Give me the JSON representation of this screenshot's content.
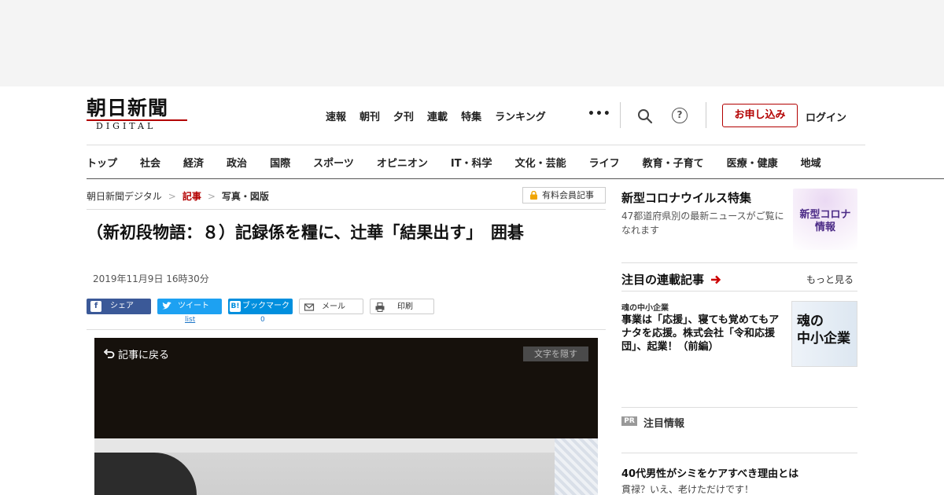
{
  "logo": {
    "jp": "朝日新聞",
    "en": "DIGITAL"
  },
  "topnav": [
    "速報",
    "朝刊",
    "夕刊",
    "連載",
    "特集",
    "ランキング"
  ],
  "more_dots": "•••",
  "header": {
    "apply_label": "お申し込み",
    "login_label": "ログイン",
    "help_glyph": "?"
  },
  "catnav": [
    "トップ",
    "社会",
    "経済",
    "政治",
    "国際",
    "スポーツ",
    "オピニオン",
    "IT・科学",
    "文化・芸能",
    "ライフ",
    "教育・子育て",
    "医療・健康",
    "地域"
  ],
  "breadcrumb": {
    "home": "朝日新聞デジタル",
    "section": "記事",
    "current": "写真・図版",
    "sep": ">"
  },
  "member_badge": "有料会員記事",
  "article": {
    "title": "（新初段物語：８）記録係を糧に、辻華「結果出す」　囲碁",
    "date": "2019年11月9日 16時30分"
  },
  "share": {
    "facebook": "シェア",
    "twitter": "ツイート",
    "hatena": "ブックマーク",
    "mail": "メール",
    "print": "印刷",
    "twitter_count": "list",
    "hatena_count": "0"
  },
  "viewer": {
    "back": "記事に戻る",
    "hide_text": "文字を隠す"
  },
  "sidebar": {
    "corona": {
      "title": "新型コロナウイルス特集",
      "desc": "47都道府県別の最新ニュースがご覧になれます",
      "img_line1": "新型コロナ",
      "img_line2": "情報"
    },
    "series": {
      "heading": "注目の連載記事",
      "more": "もっと見る",
      "tag": "魂の中小企業",
      "text": "事業は「応援」、寝ても覚めてもアナタを応援。株式会社「令和応援団」、起業！（前編）",
      "img_line1": "魂の",
      "img_line2": "中小企業"
    },
    "pr": {
      "badge": "PR",
      "label": "注目情報",
      "title": "40代男性がシミをケアすべき理由とは",
      "sub": "貫禄？いえ、老けただけです！"
    }
  },
  "colors": {
    "accent": "#b30000",
    "facebook": "#3b5998",
    "twitter": "#1da1f2",
    "hatena": "#008fde"
  }
}
